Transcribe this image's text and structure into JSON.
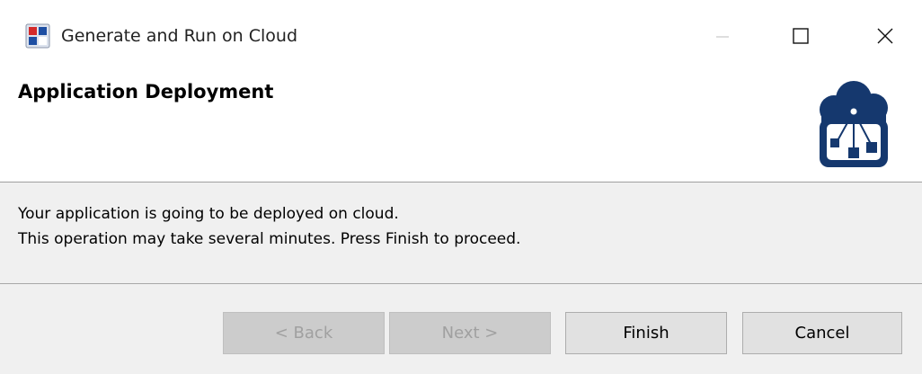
{
  "window": {
    "title": "Generate and Run on Cloud",
    "icon": "app-icon"
  },
  "controls": {
    "minimize_icon": "minimize-icon",
    "maximize_icon": "maximize-icon",
    "close_icon": "close-icon"
  },
  "header": {
    "title": "Application Deployment",
    "logo_icon": "cloud-deployment-icon"
  },
  "message": {
    "line1": "Your application is going to be deployed on cloud.",
    "line2": "This operation may take several minutes. Press Finish to proceed."
  },
  "buttons": {
    "back": "< Back",
    "next": "Next >",
    "finish": "Finish",
    "cancel": "Cancel"
  },
  "colors": {
    "logo_navy": "#15386e",
    "window_bg": "#f0f0f0",
    "header_bg": "#ffffff"
  }
}
